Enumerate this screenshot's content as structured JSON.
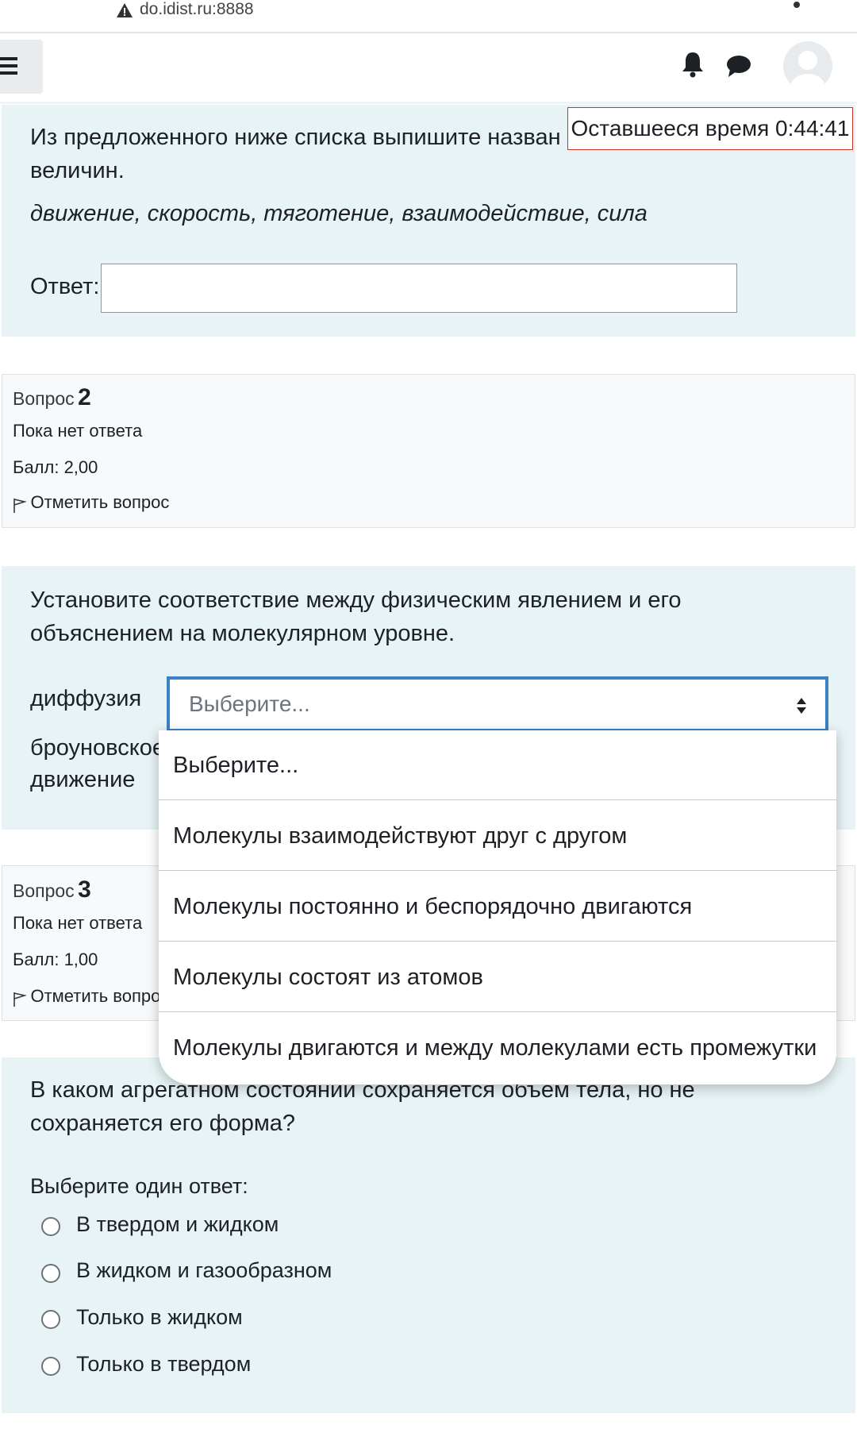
{
  "browser": {
    "url": "do.idist.ru:8888"
  },
  "timer": {
    "text": "Оставшееся время 0:44:41"
  },
  "q1": {
    "text": "Из предложенного ниже списка выпишите назван",
    "text_line2": "величин.",
    "words": "движение, скорость, тяготение, взаимодействие, сила",
    "answer_label": "Ответ:",
    "answer_value": ""
  },
  "q2_info": {
    "label": "Вопрос",
    "number": "2",
    "status": "Пока нет ответа",
    "grade": "Балл: 2,00",
    "flag": "Отметить вопрос"
  },
  "q2": {
    "text": "Установите соответствие между физическим явлением и его объяснением на молекулярном уровне.",
    "match_1": "диффузия",
    "match_2": "броуновское движение",
    "select_value": "Выберите...",
    "options": [
      "Выберите...",
      "Молекулы взаимодействуют друг с другом",
      "Молекулы постоянно и беспорядочно двигаются",
      "Молекулы состоят из атомов",
      "Молекулы двигаются и между молекулами есть промежутки"
    ]
  },
  "q3_info": {
    "label": "Вопрос",
    "number": "3",
    "status": "Пока нет ответа",
    "grade": "Балл: 1,00",
    "flag": "Отметить вопрос"
  },
  "q3": {
    "text": "В каком агрегатном состоянии сохраняется объем тела, но не сохраняется его форма?",
    "prompt": "Выберите один ответ:",
    "choices": [
      "В твердом и жидком",
      "В жидком и газообразном",
      "Только в жидком",
      "Только в твердом"
    ]
  },
  "icons": {
    "warning": "warning-icon",
    "menu": "hamburger-icon",
    "bell": "bell-icon",
    "chat": "chat-icon",
    "avatar": "user-avatar-icon",
    "flag": "flag-icon",
    "arrows": "select-arrows-icon"
  }
}
